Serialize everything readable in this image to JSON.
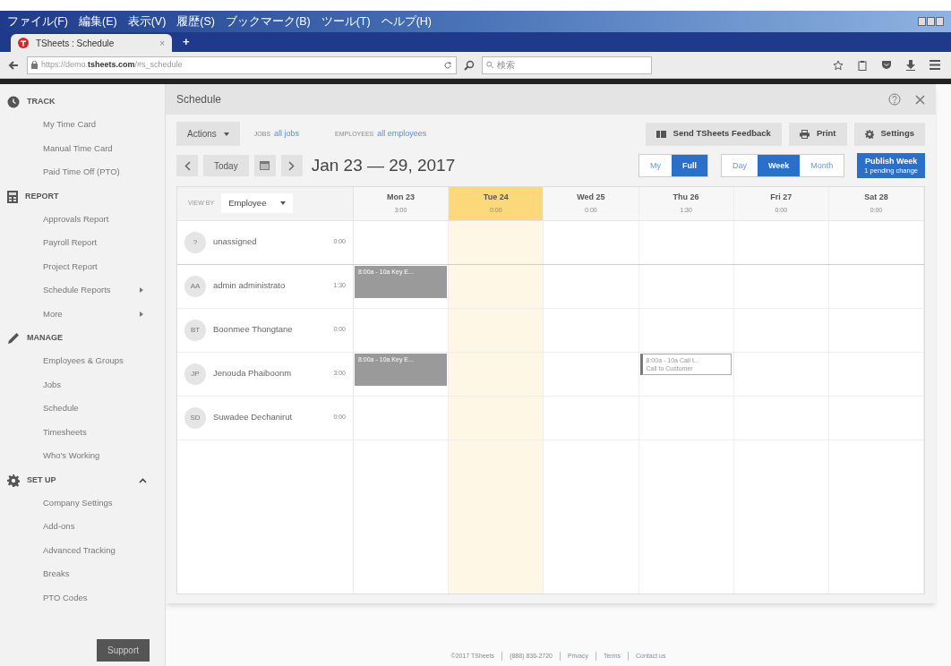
{
  "browser": {
    "menu": [
      "ファイル(F)",
      "編集(E)",
      "表示(V)",
      "履歴(S)",
      "ブックマーク(B)",
      "ツール(T)",
      "ヘルプ(H)"
    ],
    "tab": {
      "title": "TSheets : Schedule",
      "close": "×",
      "new": "+"
    },
    "url": {
      "prefix": "https://demo.",
      "domain": "tsheets.com",
      "path": "/#s_schedule"
    },
    "search": {
      "placeholder": "検索"
    }
  },
  "sidebar": {
    "sections": [
      {
        "kind": "track",
        "title": "TRACK",
        "expanded": false,
        "items": [
          {
            "label": "My Time Card",
            "submenu": false
          },
          {
            "label": "Manual Time Card",
            "submenu": false
          },
          {
            "label": "Paid Time Off (PTO)",
            "submenu": false
          }
        ]
      },
      {
        "kind": "report",
        "title": "REPORT",
        "expanded": false,
        "items": [
          {
            "label": "Approvals Report",
            "submenu": false
          },
          {
            "label": "Payroll Report",
            "submenu": false
          },
          {
            "label": "Project Report",
            "submenu": false
          },
          {
            "label": "Schedule Reports",
            "submenu": true
          },
          {
            "label": "More",
            "submenu": true
          }
        ]
      },
      {
        "kind": "manage",
        "title": "MANAGE",
        "expanded": false,
        "items": [
          {
            "label": "Employees & Groups",
            "submenu": false
          },
          {
            "label": "Jobs",
            "submenu": false
          },
          {
            "label": "Schedule",
            "submenu": false
          },
          {
            "label": "Timesheets",
            "submenu": false
          },
          {
            "label": "Who's Working",
            "submenu": false
          }
        ]
      },
      {
        "kind": "setup",
        "title": "SET UP",
        "expanded": true,
        "items": [
          {
            "label": "Company Settings",
            "submenu": false
          },
          {
            "label": "Add-ons",
            "submenu": false
          },
          {
            "label": "Advanced Tracking",
            "submenu": false
          },
          {
            "label": "Breaks",
            "submenu": false
          },
          {
            "label": "PTO Codes",
            "submenu": false
          }
        ]
      }
    ],
    "support": "Support"
  },
  "panel": {
    "title": "Schedule",
    "actions": "Actions",
    "filters": [
      {
        "label": "JOBS",
        "value": "all jobs"
      },
      {
        "label": "EMPLOYEES",
        "value": "all employees"
      }
    ],
    "buttons": [
      {
        "kind": "feedback",
        "label": "Send TSheets Feedback"
      },
      {
        "kind": "print",
        "label": "Print"
      },
      {
        "kind": "settings",
        "label": "Settings"
      }
    ],
    "today": "Today",
    "range": "Jan 23 — 29, 2017",
    "scope": [
      {
        "label": "My",
        "selected": false
      },
      {
        "label": "Full",
        "selected": true
      }
    ],
    "views": [
      {
        "label": "Day",
        "selected": false
      },
      {
        "label": "Week",
        "selected": true
      },
      {
        "label": "Month",
        "selected": false
      }
    ],
    "publish": {
      "label": "Publish Week",
      "note": "1 pending change"
    },
    "view_by": {
      "label": "VIEW BY",
      "value": "Employee"
    },
    "days": [
      {
        "label": "Mon 23",
        "hours": "3:00",
        "selected": false
      },
      {
        "label": "Tue 24",
        "hours": "0:00",
        "selected": true
      },
      {
        "label": "Wed 25",
        "hours": "0:00",
        "selected": false
      },
      {
        "label": "Thu 26",
        "hours": "1:30",
        "selected": false
      },
      {
        "label": "Fri 27",
        "hours": "0:00",
        "selected": false
      },
      {
        "label": "Sat 28",
        "hours": "0:00",
        "selected": false
      }
    ],
    "employees": [
      {
        "initials": "?",
        "name": "unassigned",
        "hours": "0:00",
        "cells": [
          {},
          {},
          {},
          {},
          {},
          {}
        ]
      },
      {
        "initials": "AA",
        "name": "admin administrato",
        "hours": "1:30",
        "cells": [
          {
            "shift": {
              "kind": "published",
              "lines": [
                "8:00a - 10a Key E..."
              ]
            }
          },
          {},
          {},
          {},
          {},
          {}
        ]
      },
      {
        "initials": "BT",
        "name": "Boonmee Thongtane",
        "hours": "0:00",
        "cells": [
          {},
          {},
          {},
          {},
          {},
          {}
        ]
      },
      {
        "initials": "JP",
        "name": "Jenouda Phaiboonm",
        "hours": "3:00",
        "cells": [
          {
            "shift": {
              "kind": "published",
              "lines": [
                "8:00a - 10a Key E..."
              ]
            }
          },
          {},
          {},
          {
            "shift": {
              "kind": "draft",
              "lines": [
                "8:00a - 10a Call t...",
                "Call to Customer"
              ]
            }
          },
          {},
          {}
        ]
      },
      {
        "initials": "SD",
        "name": "Suwadee Dechanirut",
        "hours": "0:00",
        "cells": [
          {},
          {},
          {},
          {},
          {},
          {}
        ]
      }
    ]
  },
  "footer": [
    {
      "text": "©2017 TSheets",
      "link": false
    },
    {
      "text": "(888) 836-2720",
      "link": false
    },
    {
      "text": "Privacy",
      "link": true
    },
    {
      "text": "Terms",
      "link": true
    },
    {
      "text": "Contact us",
      "link": true
    }
  ]
}
